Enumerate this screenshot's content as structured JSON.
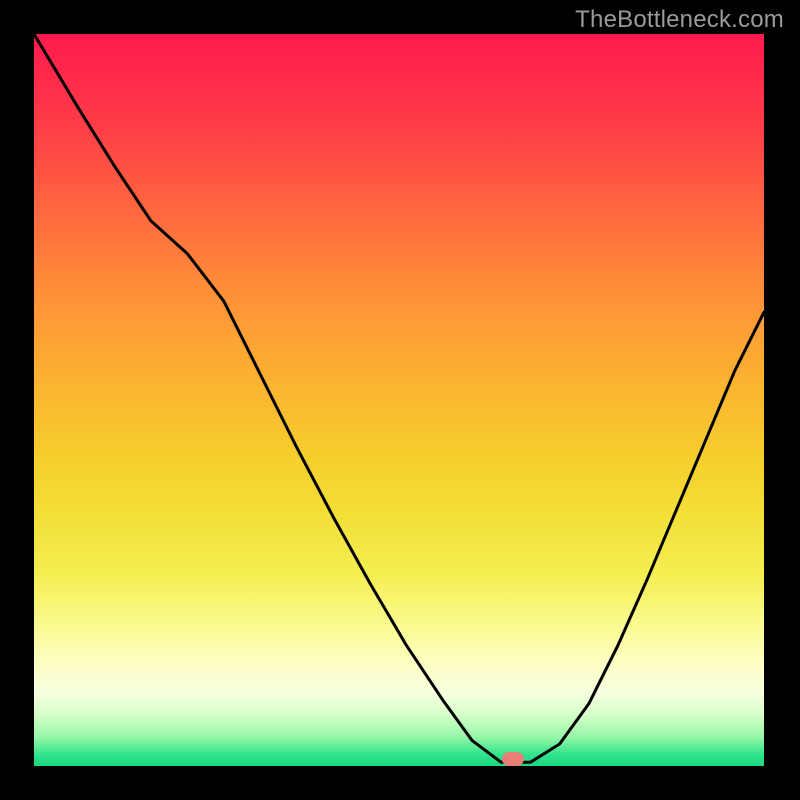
{
  "watermark": "TheBottleneck.com",
  "marker": {
    "x_rel": 0.656,
    "y_rel": 0.99
  },
  "chart_data": {
    "type": "line",
    "title": "",
    "xlabel": "",
    "ylabel": "",
    "xlim": [
      0,
      1
    ],
    "ylim": [
      0,
      1
    ],
    "series": [
      {
        "name": "bottleneck-curve",
        "x": [
          0.0,
          0.06,
          0.11,
          0.16,
          0.21,
          0.26,
          0.31,
          0.36,
          0.41,
          0.46,
          0.51,
          0.56,
          0.6,
          0.64,
          0.68,
          0.72,
          0.76,
          0.8,
          0.84,
          0.88,
          0.92,
          0.96,
          1.0
        ],
        "y": [
          1.0,
          0.9,
          0.82,
          0.745,
          0.7,
          0.635,
          0.535,
          0.435,
          0.34,
          0.25,
          0.165,
          0.09,
          0.035,
          0.005,
          0.005,
          0.03,
          0.085,
          0.165,
          0.255,
          0.35,
          0.445,
          0.54,
          0.62
        ]
      }
    ],
    "background_gradient_stops": [
      {
        "pos": 0.0,
        "color": "#ff1a4d"
      },
      {
        "pos": 0.12,
        "color": "#ff3b48"
      },
      {
        "pos": 0.25,
        "color": "#ff6a3e"
      },
      {
        "pos": 0.35,
        "color": "#ff8f38"
      },
      {
        "pos": 0.48,
        "color": "#fbb430"
      },
      {
        "pos": 0.58,
        "color": "#f6cf2c"
      },
      {
        "pos": 0.66,
        "color": "#f3e038"
      },
      {
        "pos": 0.74,
        "color": "#f4ef52"
      },
      {
        "pos": 0.8,
        "color": "#faf98a"
      },
      {
        "pos": 0.86,
        "color": "#feffc3"
      },
      {
        "pos": 0.9,
        "color": "#f7ffde"
      },
      {
        "pos": 0.93,
        "color": "#d6ffc9"
      },
      {
        "pos": 0.96,
        "color": "#97f7a7"
      },
      {
        "pos": 0.985,
        "color": "#2fe38c"
      },
      {
        "pos": 1.0,
        "color": "#1ad880"
      }
    ],
    "marker": {
      "name": "current-point",
      "x": 0.656,
      "y": 0.01,
      "color": "#e97f74"
    }
  }
}
